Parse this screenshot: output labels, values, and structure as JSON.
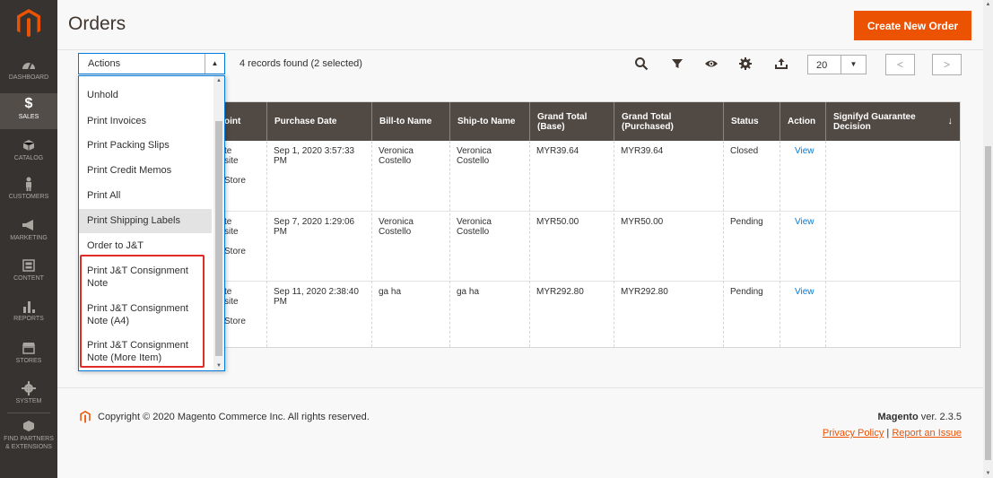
{
  "sidebar": {
    "items": [
      {
        "label": "DASHBOARD",
        "icon": "dashboard-icon"
      },
      {
        "label": "SALES",
        "icon": "dollar-icon"
      },
      {
        "label": "CATALOG",
        "icon": "cube-icon"
      },
      {
        "label": "CUSTOMERS",
        "icon": "person-icon"
      },
      {
        "label": "MARKETING",
        "icon": "megaphone-icon"
      },
      {
        "label": "CONTENT",
        "icon": "content-icon"
      },
      {
        "label": "REPORTS",
        "icon": "bar-chart-icon"
      },
      {
        "label": "STORES",
        "icon": "store-icon"
      },
      {
        "label": "SYSTEM",
        "icon": "gear-icon"
      },
      {
        "label": "FIND PARTNERS",
        "label2": "& EXTENSIONS",
        "icon": "partners-icon"
      }
    ],
    "active": "SALES"
  },
  "header": {
    "title": "Orders",
    "create_button": "Create New Order"
  },
  "toolbar": {
    "actions_label": "Actions",
    "records_text": "4 records found (2 selected)",
    "per_page": "20"
  },
  "actions_menu": {
    "items": [
      "Unhold",
      "Print Invoices",
      "Print Packing Slips",
      "Print Credit Memos",
      "Print All",
      "Print Shipping Labels",
      "Order to J&T",
      "Print J&T Consignment Note",
      "Print J&T Consignment Note (A4)",
      "Print J&T Consignment Note (More Item)"
    ],
    "hovered": "Print Shipping Labels",
    "highlighted": [
      "Print J&T Consignment Note",
      "Print J&T Consignment Note (A4)",
      "Print J&T Consignment Note (More Item)"
    ]
  },
  "grid": {
    "columns": [
      "oint",
      "Purchase Date",
      "Bill-to Name",
      "Ship-to Name",
      "Grand Total (Base)",
      "Grand Total (Purchased)",
      "Status",
      "Action",
      "Signifyd Guarantee Decision"
    ],
    "rows": [
      {
        "purchase_point": [
          "te",
          "site",
          "",
          "Store"
        ],
        "purchase_date": "Sep 1, 2020 3:57:33 PM",
        "bill_to": "Veronica Costello",
        "ship_to": "Veronica Costello",
        "grand_total_base": "MYR39.64",
        "grand_total_purchased": "MYR39.64",
        "status": "Closed",
        "action": "View"
      },
      {
        "purchase_point": [
          "te",
          "site",
          "",
          "Store"
        ],
        "purchase_date": "Sep 7, 2020 1:29:06 PM",
        "bill_to": "Veronica Costello",
        "ship_to": "Veronica Costello",
        "grand_total_base": "MYR50.00",
        "grand_total_purchased": "MYR50.00",
        "status": "Pending",
        "action": "View"
      },
      {
        "purchase_point": [
          "te",
          "site",
          "",
          "Store"
        ],
        "purchase_date": "Sep 11, 2020 2:38:40 PM",
        "bill_to": "ga ha",
        "ship_to": "ga ha",
        "grand_total_base": "MYR292.80",
        "grand_total_purchased": "MYR292.80",
        "status": "Pending",
        "action": "View"
      }
    ]
  },
  "footer": {
    "copyright": "Copyright © 2020 Magento Commerce Inc. All rights reserved.",
    "brand": "Magento",
    "version": " ver. 2.3.5",
    "privacy": "Privacy Policy",
    "separator": " | ",
    "report": "Report an Issue"
  },
  "colors": {
    "accent": "#eb5202",
    "sidebar": "#373330",
    "table_header": "#514943",
    "link": "#007bdb",
    "highlight": "#e02b27"
  }
}
